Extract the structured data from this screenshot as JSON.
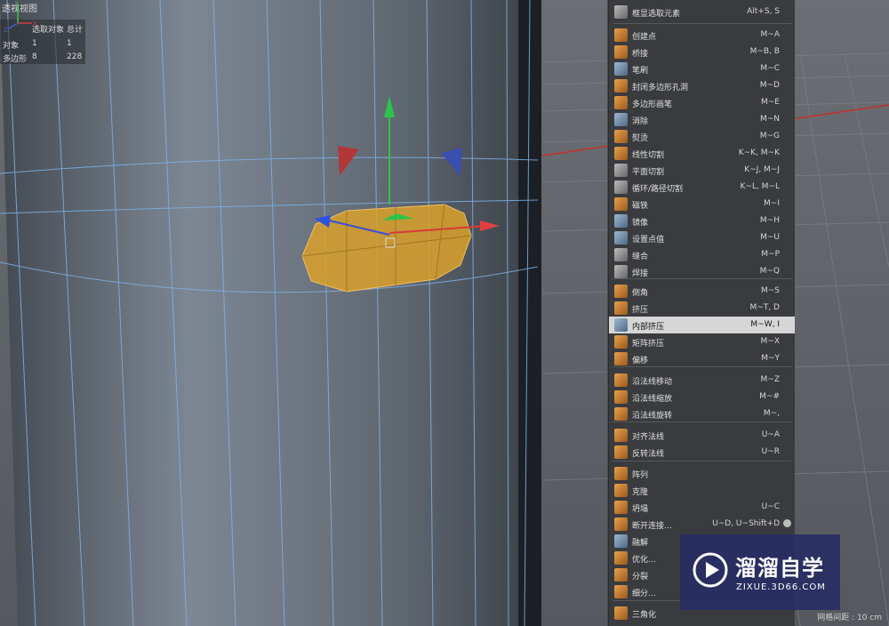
{
  "viewport": {
    "title": "透视视图",
    "stats": {
      "headers": [
        "选取对象",
        "总计"
      ],
      "rows": [
        {
          "label": "对象",
          "selected": "1",
          "total": "1"
        },
        {
          "label": "多边形",
          "selected": "8",
          "total": "228"
        }
      ]
    },
    "grid_label": "网格间距 : 10 cm",
    "axis_labels": {
      "y": "Y",
      "x": "X",
      "z": "Z"
    }
  },
  "menu": {
    "highlighted": "内部挤压",
    "items": [
      {
        "label": "框显选取元素",
        "shortcut": "Alt+S, S",
        "icon": "frame-selection-icon"
      },
      {
        "label": "创建点",
        "shortcut": "M~A",
        "icon": "create-point-icon"
      },
      {
        "label": "桥接",
        "shortcut": "M~B, B",
        "icon": "bridge-icon"
      },
      {
        "label": "笔刷",
        "shortcut": "M~C",
        "icon": "brush-icon"
      },
      {
        "label": "封闭多边形孔洞",
        "shortcut": "M~D",
        "icon": "close-hole-icon"
      },
      {
        "label": "多边形画笔",
        "shortcut": "M~E",
        "icon": "polygon-pen-icon"
      },
      {
        "label": "消除",
        "shortcut": "M~N",
        "icon": "dissolve-icon"
      },
      {
        "label": "熨烫",
        "shortcut": "M~G",
        "icon": "iron-icon"
      },
      {
        "label": "线性切割",
        "shortcut": "K~K, M~K",
        "icon": "line-cut-icon"
      },
      {
        "label": "平面切割",
        "shortcut": "K~J, M~J",
        "icon": "plane-cut-icon"
      },
      {
        "label": "循环/路径切割",
        "shortcut": "K~L, M~L",
        "icon": "loop-cut-icon"
      },
      {
        "label": "磁铁",
        "shortcut": "M~I",
        "icon": "magnet-icon"
      },
      {
        "label": "镜像",
        "shortcut": "M~H",
        "icon": "mirror-icon"
      },
      {
        "label": "设置点值",
        "shortcut": "M~U",
        "icon": "set-point-value-icon"
      },
      {
        "label": "缝合",
        "shortcut": "M~P",
        "icon": "stitch-icon"
      },
      {
        "label": "焊接",
        "shortcut": "M~Q",
        "icon": "weld-icon"
      },
      {
        "label": "倒角",
        "shortcut": "M~S",
        "icon": "bevel-icon"
      },
      {
        "label": "挤压",
        "shortcut": "M~T, D",
        "icon": "extrude-icon"
      },
      {
        "label": "内部挤压",
        "shortcut": "M~W, I",
        "icon": "inner-extrude-icon"
      },
      {
        "label": "矩阵挤压",
        "shortcut": "M~X",
        "icon": "matrix-extrude-icon"
      },
      {
        "label": "偏移",
        "shortcut": "M~Y",
        "icon": "offset-icon"
      },
      {
        "label": "沿法线移动",
        "shortcut": "M~Z",
        "icon": "normal-move-icon"
      },
      {
        "label": "沿法线缩放",
        "shortcut": "M~#",
        "icon": "normal-scale-icon"
      },
      {
        "label": "沿法线旋转",
        "shortcut": "M~,",
        "icon": "normal-rotate-icon"
      },
      {
        "label": "对齐法线",
        "shortcut": "U~A",
        "icon": "align-normals-icon"
      },
      {
        "label": "反转法线",
        "shortcut": "U~R",
        "icon": "reverse-normals-icon"
      },
      {
        "label": "阵列",
        "shortcut": "",
        "icon": "array-icon"
      },
      {
        "label": "克隆",
        "shortcut": "",
        "icon": "clone-icon"
      },
      {
        "label": "坍塌",
        "shortcut": "U~C",
        "icon": "collapse-icon"
      },
      {
        "label": "断开连接...",
        "shortcut": "U~D, U~Shift+D",
        "icon": "disconnect-icon"
      },
      {
        "label": "融解",
        "shortcut": "",
        "icon": "melt-icon"
      },
      {
        "label": "优化...",
        "shortcut": "",
        "icon": "optimize-icon"
      },
      {
        "label": "分裂",
        "shortcut": "",
        "icon": "split-icon"
      },
      {
        "label": "细分...",
        "shortcut": "",
        "icon": "subdivide-icon"
      },
      {
        "label": "三角化",
        "shortcut": "",
        "icon": "triangulate-icon"
      }
    ]
  },
  "watermark": {
    "title": "溜溜自学",
    "subtitle": "ZIXUE.3D66.COM"
  },
  "colors": {
    "highlight": "#d6d6d6",
    "selection": "#d9a12a",
    "wire": "#8fb8e8"
  }
}
